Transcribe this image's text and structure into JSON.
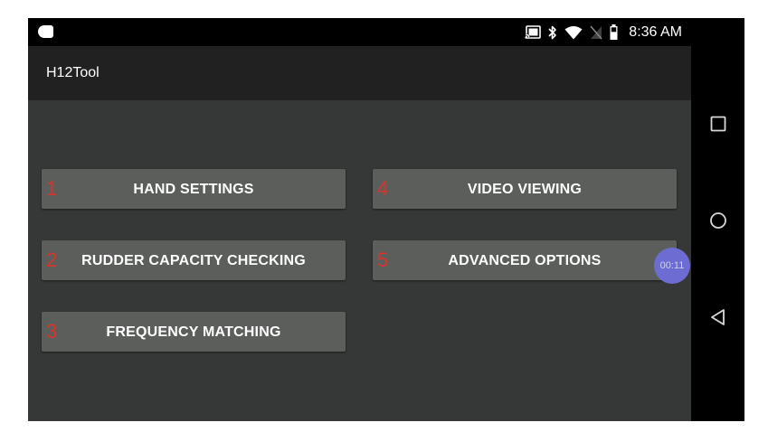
{
  "status_bar": {
    "time": "8:36 AM",
    "icons": [
      "notification-icon",
      "cast-icon",
      "bluetooth-icon",
      "wifi-icon",
      "no-sim-icon",
      "battery-icon"
    ]
  },
  "app": {
    "title": "H12Tool"
  },
  "menu": {
    "buttons": [
      {
        "number": "1",
        "label": "HAND SETTINGS"
      },
      {
        "number": "2",
        "label": "RUDDER CAPACITY CHECKING"
      },
      {
        "number": "3",
        "label": "FREQUENCY MATCHING"
      },
      {
        "number": "4",
        "label": "VIDEO VIEWING"
      },
      {
        "number": "5",
        "label": "ADVANCED OPTIONS"
      }
    ]
  },
  "recording_badge": {
    "time": "00:11"
  },
  "nav_bar": {
    "icons": [
      "recents-icon",
      "home-icon",
      "back-icon"
    ]
  },
  "colors": {
    "screen_background": "#353836",
    "action_bar": "#212121",
    "button": "#5c5e5c",
    "number_annotation": "#d8342c",
    "badge": "#6c6cd2"
  }
}
